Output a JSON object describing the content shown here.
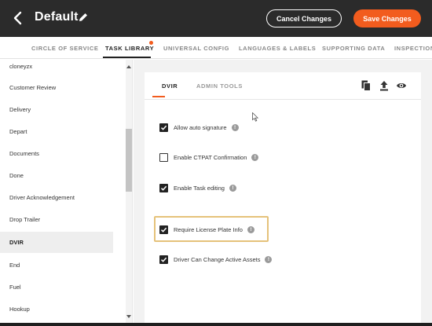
{
  "header": {
    "title": "Default",
    "cancel_label": "Cancel Changes",
    "save_label": "Save Changes"
  },
  "tabs": [
    {
      "label": "CIRCLE OF SERVICE"
    },
    {
      "label": "TASK LIBRARY"
    },
    {
      "label": "UNIVERSAL CONFIG"
    },
    {
      "label": "LANGUAGES & LABELS"
    },
    {
      "label": "SUPPORTING DATA"
    },
    {
      "label": "INSPECTIONS"
    }
  ],
  "active_tab": "TASK LIBRARY",
  "sidebar": {
    "items": [
      {
        "label": "cloneyzx"
      },
      {
        "label": "Customer Review"
      },
      {
        "label": "Delivery"
      },
      {
        "label": "Depart"
      },
      {
        "label": "Documents"
      },
      {
        "label": "Done"
      },
      {
        "label": "Driver Acknowledgement"
      },
      {
        "label": "Drop Trailer"
      },
      {
        "label": "DVIR"
      },
      {
        "label": "End"
      },
      {
        "label": "Fuel"
      },
      {
        "label": "Hookup"
      }
    ],
    "selected": "DVIR"
  },
  "panel": {
    "subtabs": [
      {
        "label": "DVIR"
      },
      {
        "label": "ADMIN TOOLS"
      }
    ],
    "active_subtab": "DVIR",
    "tools": [
      "copy-icon",
      "upload-icon",
      "eye-icon"
    ],
    "options": [
      {
        "label": "Allow auto signature",
        "checked": true
      },
      {
        "label": "Enable CTPAT Confirmation",
        "checked": false
      },
      {
        "label": "Enable Task editing",
        "checked": true
      },
      {
        "label": "Require License Plate Info",
        "checked": true
      },
      {
        "label": "Driver Can Change Active Assets",
        "checked": true
      }
    ],
    "highlighted_option": "Require License Plate Info",
    "info_glyph": "!"
  },
  "colors": {
    "accent": "#f25c1e",
    "header_bg": "#2b2b2b",
    "highlight_border": "#e5c27a"
  }
}
